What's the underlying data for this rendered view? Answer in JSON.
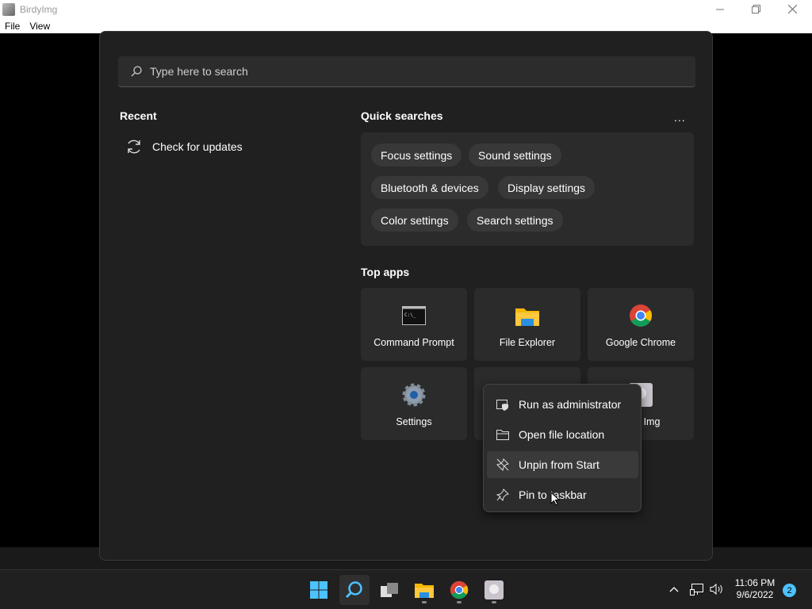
{
  "window": {
    "title": "BirdyImg",
    "menu": [
      "File",
      "View"
    ]
  },
  "start_menu": {
    "search": {
      "placeholder": "Type here to search"
    },
    "recent": {
      "title": "Recent",
      "items": [
        {
          "label": "Check for updates",
          "icon": "refresh-icon"
        }
      ]
    },
    "quick_searches": {
      "title": "Quick searches",
      "more": "...",
      "items": [
        "Focus settings",
        "Sound settings",
        "Bluetooth & devices",
        "Display settings",
        "Color settings",
        "Search settings"
      ]
    },
    "top_apps": {
      "title": "Top apps",
      "items": [
        {
          "label": "Command Prompt",
          "icon": "command-prompt-icon"
        },
        {
          "label": "File Explorer",
          "icon": "file-explorer-icon"
        },
        {
          "label": "Google Chrome",
          "icon": "chrome-icon"
        },
        {
          "label": "Settings",
          "icon": "settings-gear-icon"
        },
        {
          "label": "",
          "icon": "app-icon"
        },
        {
          "label": "Img",
          "icon": "birdyimg-icon"
        }
      ]
    }
  },
  "context_menu": {
    "items": [
      {
        "label": "Run as administrator",
        "icon": "shield-icon"
      },
      {
        "label": "Open file location",
        "icon": "folder-icon"
      },
      {
        "label": "Unpin from Start",
        "icon": "unpin-icon"
      },
      {
        "label": "Pin to taskbar",
        "icon": "pin-icon"
      }
    ]
  },
  "taskbar": {
    "apps": [
      "start-icon",
      "search-icon",
      "task-view-icon",
      "file-explorer-icon",
      "chrome-icon",
      "birdyimg-icon"
    ],
    "clock": {
      "time": "11:06 PM",
      "date": "9/6/2022"
    },
    "notifications": "2"
  },
  "colors": {
    "accent": "#4cc2ff",
    "panel": "#202020",
    "tile": "#2b2b2b"
  }
}
